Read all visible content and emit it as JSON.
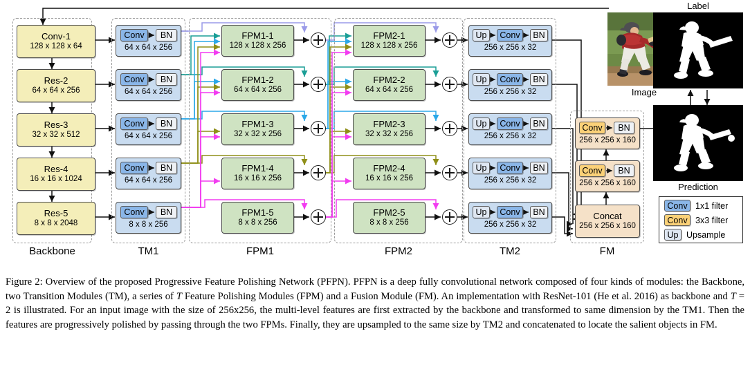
{
  "figure": {
    "label": "Figure 2:",
    "caption_p1": "Figure 2: Overview of the proposed Progressive Feature Polishing Network (PFPN). PFPN is a deep fully convolutional network composed of four kinds of modules: the Backbone, two Transition Modules (TM), a series of ",
    "caption_T1": "T",
    "caption_p2": " Feature Polishing Modules (FPM) and a Fusion Module (FM). An implementation with ResNet-101 (He et al. 2016) as backbone and ",
    "caption_T2": "T",
    "caption_eq": " = 2",
    "caption_p3": " is illustrated. For an input image with the size of 256x256, the multi-level features are first extracted by the backbone and transformed to same dimension by the TM1. Then the features are progressively polished by passing through the two FPMs. Finally, they are upsampled to the same size by TM2 and concatenated to locate the salient objects in FM."
  },
  "groups": [
    {
      "id": "backbone",
      "label": "Backbone"
    },
    {
      "id": "tm1",
      "label": "TM1"
    },
    {
      "id": "fpm1",
      "label": "FPM1"
    },
    {
      "id": "fpm2",
      "label": "FPM2"
    },
    {
      "id": "tm2",
      "label": "TM2"
    },
    {
      "id": "fm",
      "label": "FM"
    }
  ],
  "backbone": {
    "blocks": [
      {
        "name": "Conv-1",
        "dims": "128 x 128 x 64"
      },
      {
        "name": "Res-2",
        "dims": "64 x 64 x 256"
      },
      {
        "name": "Res-3",
        "dims": "32 x 32 x 512"
      },
      {
        "name": "Res-4",
        "dims": "16 x 16 x 1024"
      },
      {
        "name": "Res-5",
        "dims": "8 x 8 x 2048"
      }
    ]
  },
  "tm1": {
    "chip_a": "Conv",
    "chip_b": "BN",
    "blocks": [
      {
        "dims": "64 x 64 x 256"
      },
      {
        "dims": "64 x 64 x 256"
      },
      {
        "dims": "64 x 64 x 256"
      },
      {
        "dims": "64 x 64 x 256"
      },
      {
        "dims": "8 x 8 x 256"
      }
    ]
  },
  "fpm1": {
    "blocks": [
      {
        "name": "FPM1-1",
        "dims": "128 x 128 x 256"
      },
      {
        "name": "FPM1-2",
        "dims": "64 x 64 x 256"
      },
      {
        "name": "FPM1-3",
        "dims": "32 x 32 x 256"
      },
      {
        "name": "FPM1-4",
        "dims": "16 x 16 x 256"
      },
      {
        "name": "FPM1-5",
        "dims": "8 x 8 x 256"
      }
    ]
  },
  "fpm2": {
    "blocks": [
      {
        "name": "FPM2-1",
        "dims": "128 x 128 x 256"
      },
      {
        "name": "FPM2-2",
        "dims": "64 x 64 x 256"
      },
      {
        "name": "FPM2-3",
        "dims": "32 x 32 x 256"
      },
      {
        "name": "FPM2-4",
        "dims": "16 x 16 x 256"
      },
      {
        "name": "FPM2-5",
        "dims": "8 x 8 x 256"
      }
    ]
  },
  "tm2": {
    "chip_a": "Up",
    "chip_b": "Conv",
    "chip_c": "BN",
    "blocks": [
      {
        "dims": "256 x 256 x 32"
      },
      {
        "dims": "256 x 256 x 32"
      },
      {
        "dims": "256 x 256 x 32"
      },
      {
        "dims": "256 x 256 x 32"
      },
      {
        "dims": "256 x 256 x 32"
      }
    ]
  },
  "fm": {
    "blocks": [
      {
        "chip_a": "Conv",
        "chip_b": "BN",
        "dims": "256 x 256 x 160"
      },
      {
        "chip_a": "Conv",
        "chip_b": "BN",
        "dims": "256 x 256 x 160"
      }
    ],
    "concat": {
      "name": "Concat",
      "dims": "256 x 256 x 160"
    }
  },
  "images": {
    "input_caption": "Image",
    "label_caption": "Label",
    "prediction_caption": "Prediction"
  },
  "legend": {
    "rows": [
      {
        "chip": "Conv",
        "text": "1x1 filter",
        "kind": "conv1"
      },
      {
        "chip": "Conv",
        "text": "3x3 filter",
        "kind": "conv3"
      },
      {
        "chip": "Up",
        "text": "Upsample",
        "kind": "up"
      }
    ]
  },
  "colors": {
    "backbone_box": "#f4eeb9",
    "transition_box": "#c9dcf0",
    "fpm_box": "#cfe3c2",
    "fusion_box": "#f5e1c8",
    "conv_1x1": "#8ab6e8",
    "conv_3x3": "#fbd178",
    "upsample": "#dfe7f2",
    "flow_level1": "#9a9ae8",
    "flow_level2": "#1a9e96",
    "flow_level3": "#2ba8e8",
    "flow_level4": "#8f8f18",
    "flow_level5": "#f23cf0",
    "group_border": "#9a9a9a"
  }
}
